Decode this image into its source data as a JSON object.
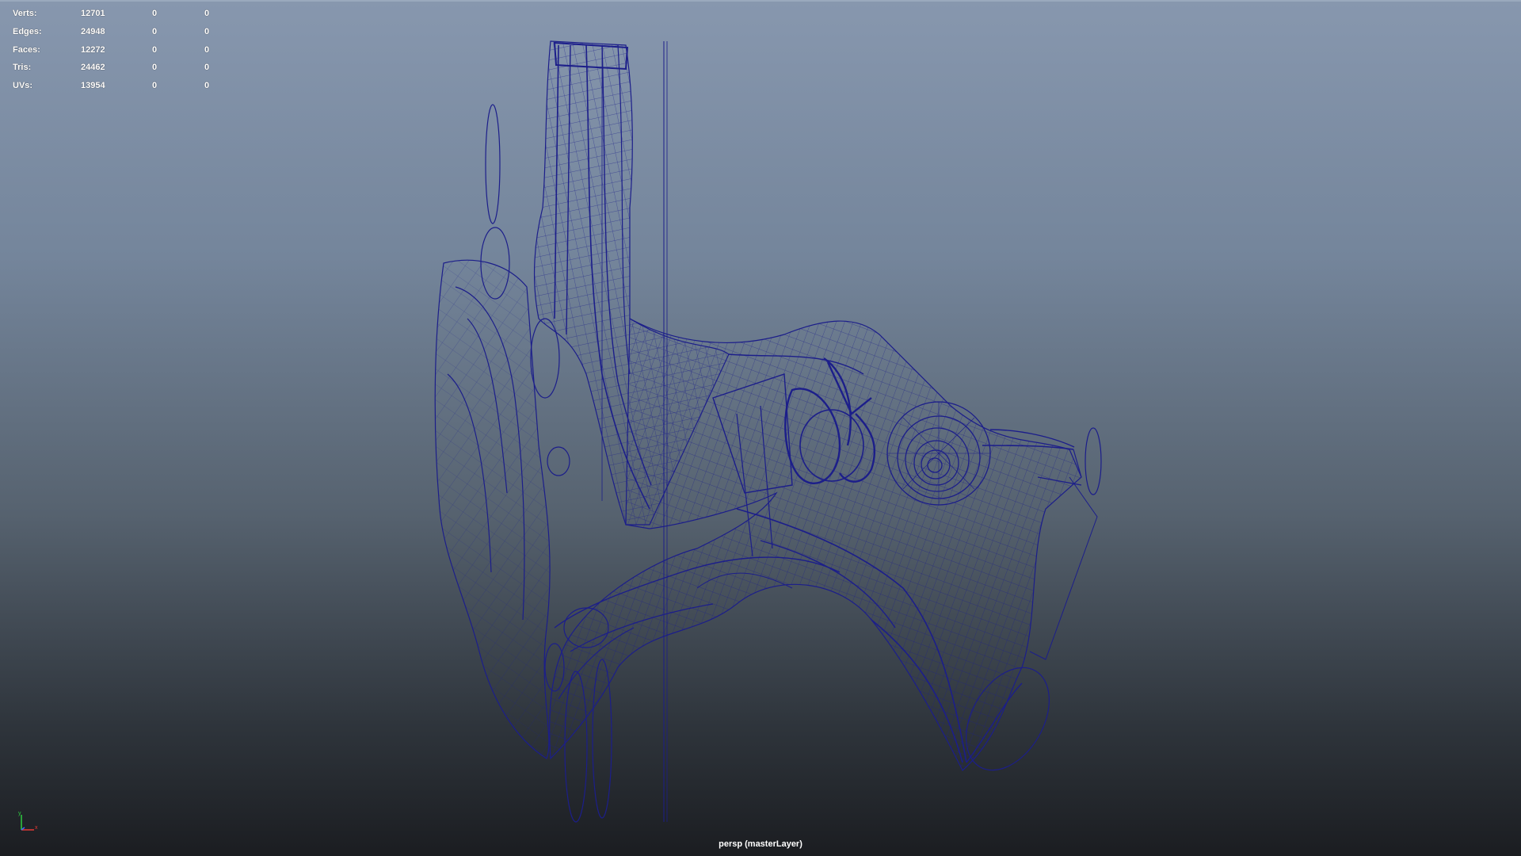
{
  "hud": {
    "rows": [
      {
        "label": "Verts:",
        "total": "12701",
        "selected": "0",
        "component": "0"
      },
      {
        "label": "Edges:",
        "total": "24948",
        "selected": "0",
        "component": "0"
      },
      {
        "label": "Faces:",
        "total": "12272",
        "selected": "0",
        "component": "0"
      },
      {
        "label": "Tris:",
        "total": "24462",
        "selected": "0",
        "component": "0"
      },
      {
        "label": "UVs:",
        "total": "13954",
        "selected": "0",
        "component": "0"
      }
    ]
  },
  "camera_label": "persp (masterLayer)",
  "axis": {
    "y_label": "y",
    "x_label": "x"
  },
  "colors": {
    "wireframe": "#1c1e8a",
    "axis_y": "#2ecc40",
    "axis_x": "#e53935",
    "axis_z": "#3b6cff"
  }
}
